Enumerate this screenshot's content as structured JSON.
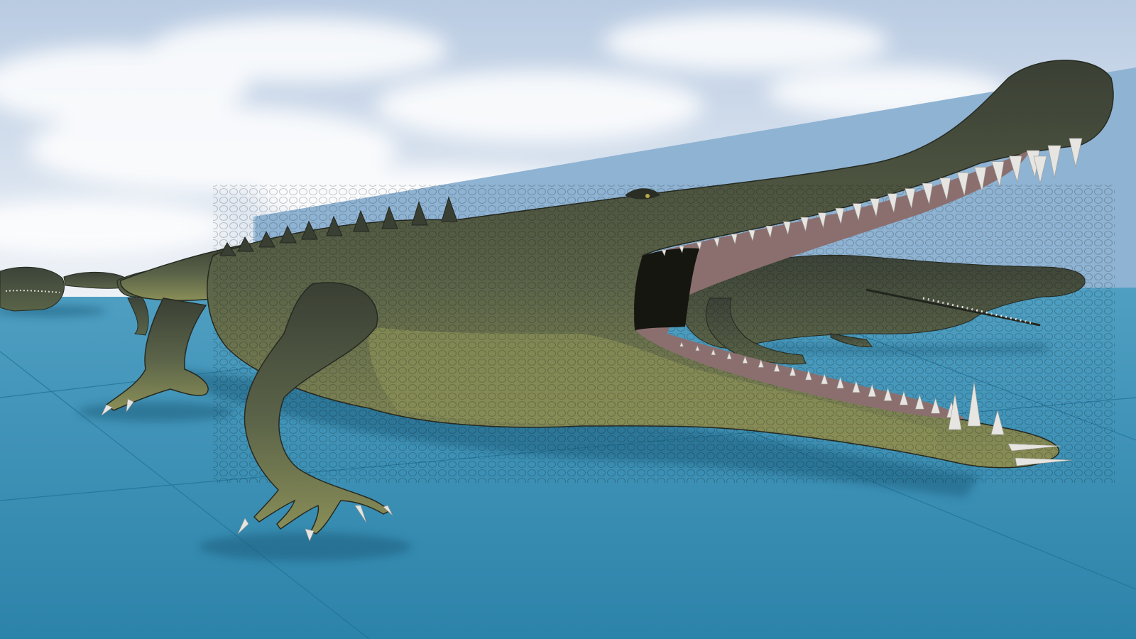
{
  "scene": {
    "sky_top_color": "#b9cbe2",
    "sky_horizon_color": "#eef2f7",
    "cloud_color": "#ffffff",
    "floor_near_color": "#2c83a9",
    "floor_far_color": "#4f9fc2",
    "floor_grid_color": "#1f6f92",
    "wall_color": "#8fb3d3",
    "wall_edge_color": "#a9c6df",
    "shadow_color": "#1d5f7f"
  },
  "creatures": {
    "main": {
      "skin_dark": "#3a3f34",
      "skin_mid": "#5b6449",
      "belly": "#8a8f57",
      "mouth_inside": "#8b6f6f",
      "tooth_color": "#e7e5e1"
    },
    "background": {
      "skin_dark": "#3c4339",
      "skin_mid": "#5a6448"
    }
  }
}
